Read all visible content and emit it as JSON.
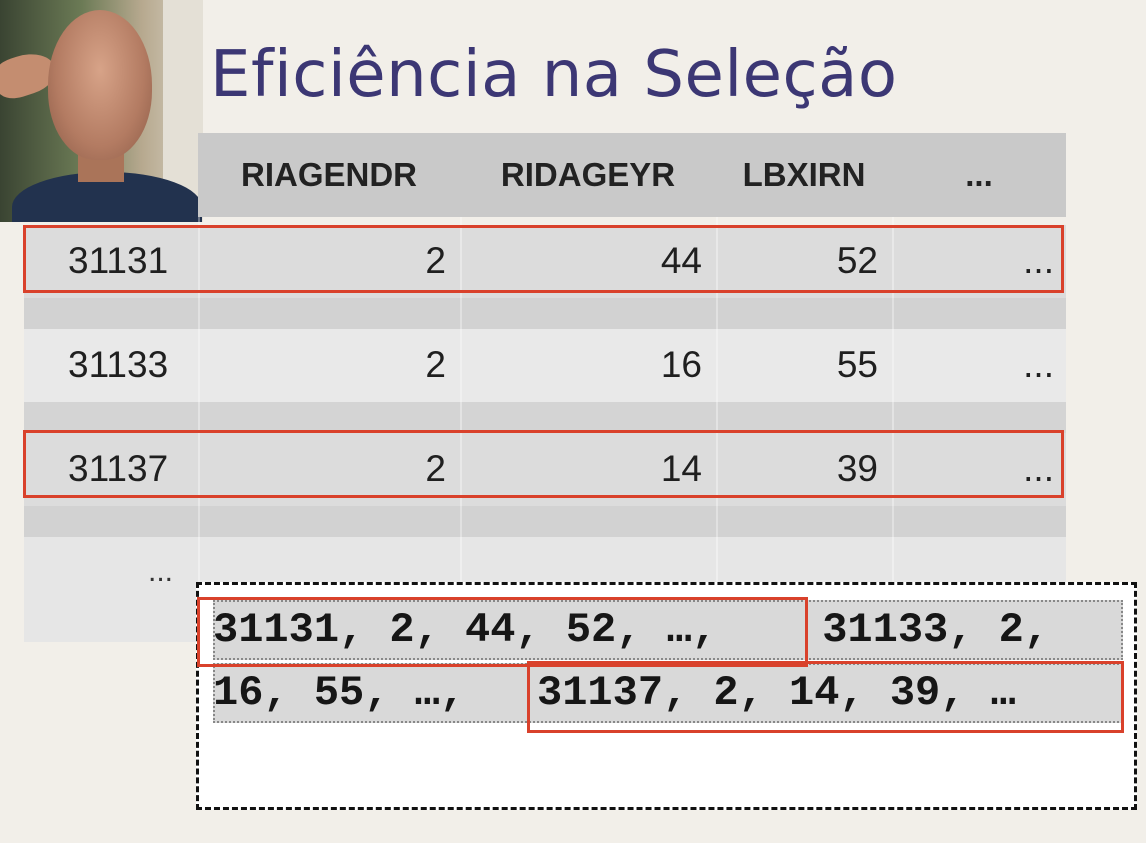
{
  "slide": {
    "title": "Eficiência na Seleção"
  },
  "table": {
    "headers": [
      "",
      "RIAGENDR",
      "RIDAGEYR",
      "LBXIRN",
      "..."
    ],
    "rows": [
      [
        "31131",
        "2",
        "44",
        "52",
        "..."
      ],
      [
        "31133",
        "2",
        "16",
        "55",
        "..."
      ],
      [
        "31137",
        "2",
        "14",
        "39",
        "..."
      ]
    ],
    "more": "..."
  },
  "stream": {
    "line1_selected": "31131, 2, 44, 52, …,",
    "line1_rest": " 31133, 2,",
    "line2_start": "16, 55, …, ",
    "line2_selected": "31137, 2, 14, 39, …"
  },
  "colors": {
    "title": "#3c3774",
    "highlight": "#d9412b",
    "header_bg": "#c9c9c9"
  },
  "webcam": {
    "icon": "presenter-video"
  }
}
